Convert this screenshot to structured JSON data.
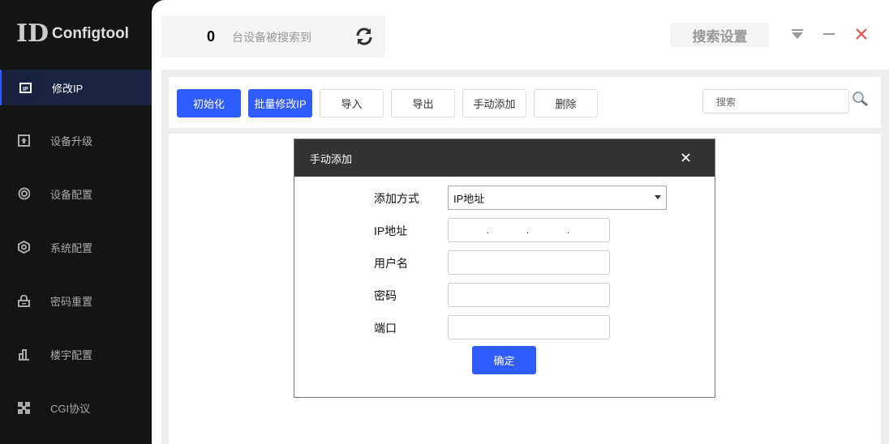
{
  "app": {
    "name": "Configtool",
    "logo_text": "ID"
  },
  "sidebar": {
    "items": [
      {
        "label": "修改IP",
        "icon": "ip-icon"
      },
      {
        "label": "设备升级",
        "icon": "upgrade-icon"
      },
      {
        "label": "设备配置",
        "icon": "target-icon"
      },
      {
        "label": "系统配置",
        "icon": "hexagon-settings-icon"
      },
      {
        "label": "密码重置",
        "icon": "lock-icon"
      },
      {
        "label": "楼宇配置",
        "icon": "building-icon"
      },
      {
        "label": "CGI协议",
        "icon": "grid-icon"
      }
    ]
  },
  "header": {
    "count": "0",
    "count_label": "台设备被搜索到",
    "search_settings": "搜索设置"
  },
  "toolbar": {
    "init": "初始化",
    "batch_modify": "批量修改IP",
    "import": "导入",
    "export": "导出",
    "manual_add": "手动添加",
    "delete": "删除",
    "search_placeholder": "搜索"
  },
  "dialog": {
    "title": "手动添加",
    "add_mode_label": "添加方式",
    "add_mode_value": "IP地址",
    "ip_label": "IP地址",
    "username_label": "用户名",
    "password_label": "密码",
    "port_label": "端口",
    "confirm": "确定"
  },
  "colors": {
    "accent": "#2f5cff",
    "sidebar": "#141414",
    "dialog_header": "#333333",
    "close": "#e84a4a"
  }
}
